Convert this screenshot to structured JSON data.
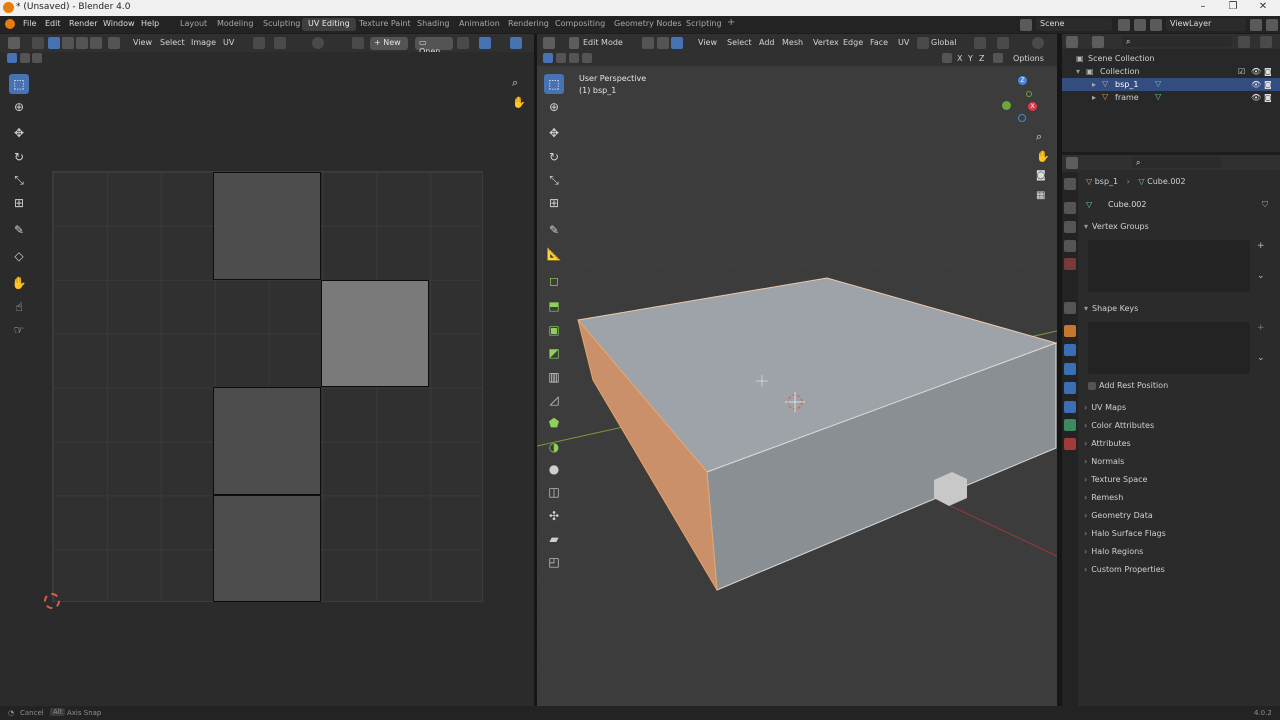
{
  "window": {
    "title": "* (Unsaved) - Blender 4.0"
  },
  "menu": {
    "file": "File",
    "edit": "Edit",
    "render": "Render",
    "window": "Window",
    "help": "Help"
  },
  "workspaces": [
    "Layout",
    "Modeling",
    "Sculpting",
    "UV Editing",
    "Texture Paint",
    "Shading",
    "Animation",
    "Rendering",
    "Compositing",
    "Geometry Nodes",
    "Scripting"
  ],
  "scene": {
    "label": "Scene",
    "view_layer": "ViewLayer"
  },
  "uv_header": {
    "view": "View",
    "select": "Select",
    "image": "Image",
    "uv": "UV",
    "new": "New",
    "open": "Open"
  },
  "vp_header": {
    "mode": "Edit Mode",
    "view": "View",
    "select": "Select",
    "add": "Add",
    "mesh": "Mesh",
    "vertex": "Vertex",
    "edge": "Edge",
    "face": "Face",
    "uv": "UV",
    "orientation": "Global",
    "options": "Options"
  },
  "vp_info": {
    "perspective": "User Perspective",
    "object": "(1) bsp_1"
  },
  "axes": {
    "x": "X",
    "y": "Y",
    "z": "Z"
  },
  "outliner": {
    "scene_collection": "Scene Collection",
    "collection": "Collection",
    "items": [
      "bsp_1",
      "frame"
    ]
  },
  "properties": {
    "object": "bsp_1",
    "mesh": "Cube.002",
    "data_name": "Cube.002",
    "vertex_groups": "Vertex Groups",
    "shape_keys": "Shape Keys",
    "add_rest_position": "Add Rest Position",
    "sections": [
      "UV Maps",
      "Color Attributes",
      "Attributes",
      "Normals",
      "Texture Space",
      "Remesh",
      "Geometry Data",
      "Halo Surface Flags",
      "Halo Regions",
      "Custom Properties"
    ]
  },
  "status": {
    "cancel": "Cancel",
    "alt": "Alt",
    "axis_snap": "Axis Snap",
    "version": "4.0.2"
  },
  "colors": {
    "accent": "#4772b3",
    "selection_orange": "#e8a46a",
    "header_bg": "#303030",
    "uv_face": "#4d4d4d",
    "uv_face_selected": "#7a7a7a"
  }
}
